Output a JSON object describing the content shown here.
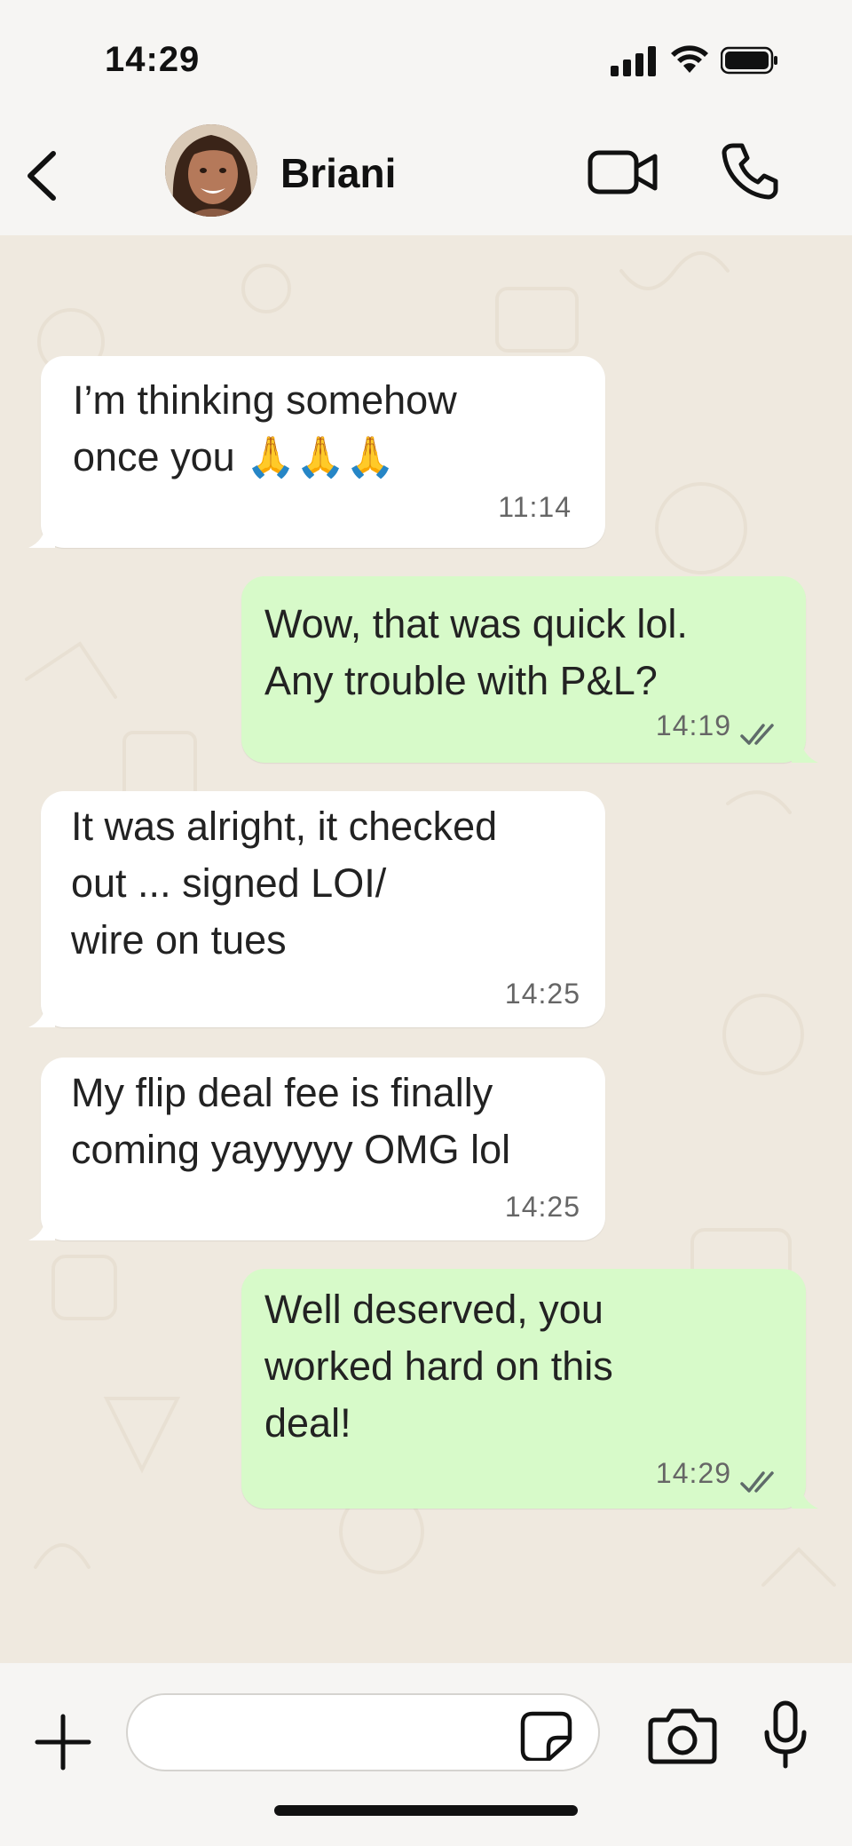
{
  "status_bar": {
    "time": "14:29"
  },
  "header": {
    "contact_name": "Briani"
  },
  "messages": [
    {
      "text": "I’m thinking somehow\nonce you 🙏🙏🙏",
      "time": "11:14",
      "direction": "in"
    },
    {
      "text": "Wow, that was quick lol.\nAny trouble with P&L?",
      "time": "14:19",
      "direction": "out",
      "status": "read"
    },
    {
      "text": "It was alright, it checked\nout ... signed LOI/\nwire on tues",
      "time": "14:25",
      "direction": "in"
    },
    {
      "text": "My flip deal fee is finally\ncoming yayyyyy OMG lol",
      "time": "14:25",
      "direction": "in"
    },
    {
      "text": "Well deserved, you\nworked hard on this\ndeal!",
      "time": "14:29",
      "direction": "out",
      "status": "read"
    }
  ],
  "composer": {
    "value": "",
    "placeholder": ""
  },
  "icons": {
    "back": "chevron-left-icon",
    "video": "video-camera-icon",
    "call": "phone-icon",
    "attach": "plus-icon",
    "sticker": "sticker-icon",
    "camera": "camera-icon",
    "voice": "microphone-icon"
  },
  "colors": {
    "incoming_bubble": "#ffffff",
    "outgoing_bubble": "#d7fac9",
    "read_ticks": "#5f6b6a",
    "chat_background": "#efe9df"
  }
}
